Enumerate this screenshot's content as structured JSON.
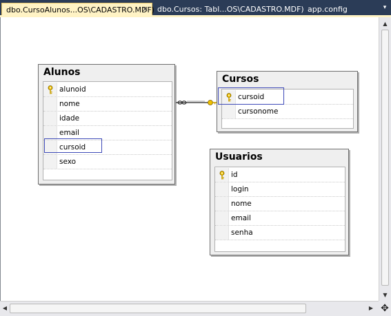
{
  "tabs": [
    {
      "label": "dbo.CursoAlunos...OS\\CADASTRO.MDF)",
      "close": "✕",
      "active": true
    },
    {
      "label": "dbo.Cursos: Tabl...OS\\CADASTRO.MDF)",
      "active": false
    },
    {
      "label": "app.config",
      "active": false
    }
  ],
  "tab_menu_icon": "▾",
  "icons": {
    "key": "key-icon",
    "scroll_up": "▲",
    "scroll_down": "▼",
    "scroll_left": "◀",
    "scroll_right": "▶",
    "pan": "✥"
  },
  "colors": {
    "accent_tab": "#fff3c5",
    "frame": "#2b3c57",
    "key": "#f0c000",
    "selection_border": "#3e4ab8"
  },
  "tables": {
    "alunos": {
      "title": "Alunos",
      "columns": [
        {
          "name": "alunoid",
          "primary_key": true
        },
        {
          "name": "nome",
          "primary_key": false
        },
        {
          "name": "idade",
          "primary_key": false
        },
        {
          "name": "email",
          "primary_key": false
        },
        {
          "name": "cursoid",
          "primary_key": false,
          "focused": true
        },
        {
          "name": "sexo",
          "primary_key": false
        }
      ]
    },
    "cursos": {
      "title": "Cursos",
      "columns": [
        {
          "name": "cursoid",
          "primary_key": true,
          "focused": true
        },
        {
          "name": "cursonome",
          "primary_key": false
        }
      ]
    },
    "usuarios": {
      "title": "Usuarios",
      "columns": [
        {
          "name": "id",
          "primary_key": true
        },
        {
          "name": "login",
          "primary_key": false
        },
        {
          "name": "nome",
          "primary_key": false
        },
        {
          "name": "email",
          "primary_key": false
        },
        {
          "name": "senha",
          "primary_key": false
        }
      ]
    }
  },
  "relationship": {
    "from": "Alunos.cursoid",
    "to": "Cursos.cursoid",
    "from_end": "many",
    "to_end": "one"
  }
}
